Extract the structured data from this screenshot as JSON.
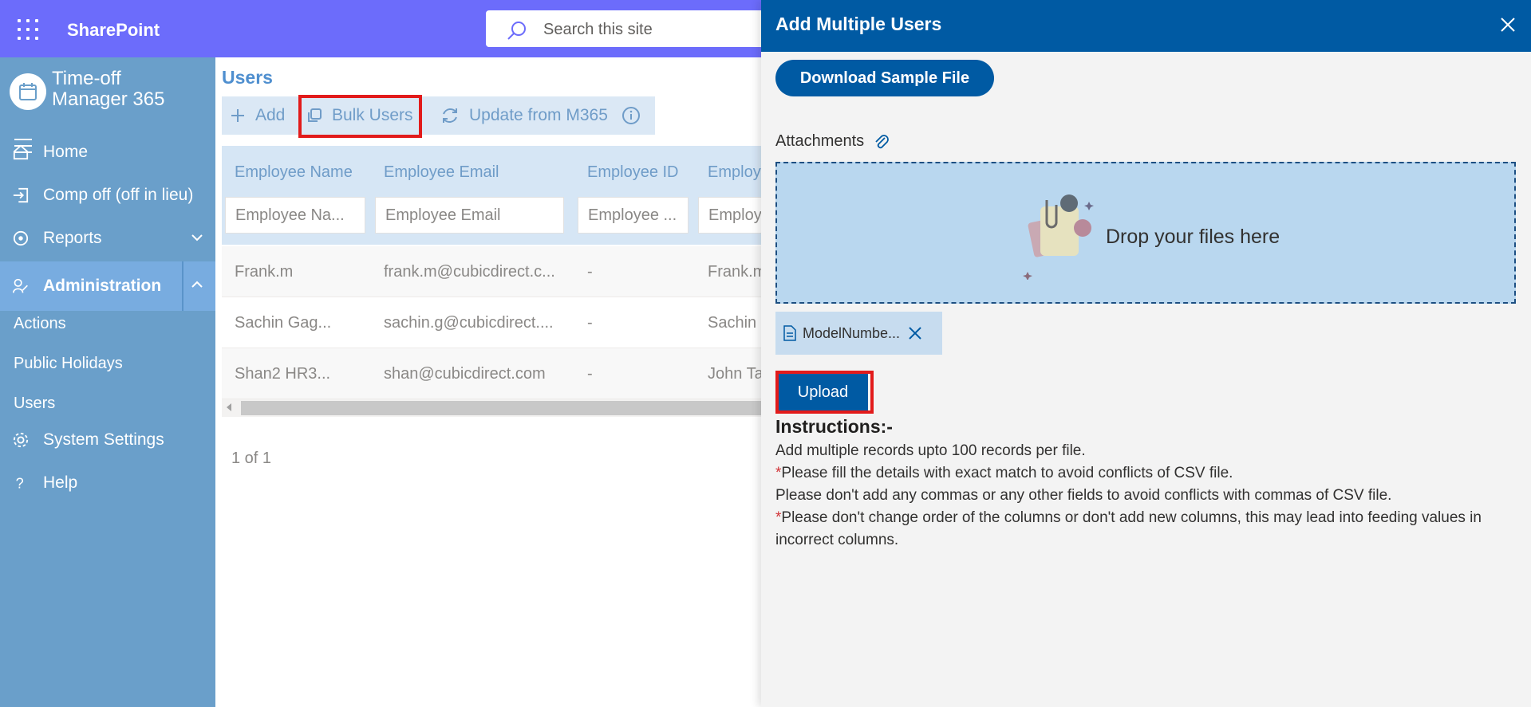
{
  "suite": {
    "app_name": "SharePoint",
    "search_placeholder": "Search this site",
    "bar_color": "#6c6cfb"
  },
  "nav": {
    "app_title_line1": "Time-off",
    "app_title_line2": "Manager 365",
    "items": [
      {
        "label": "Home",
        "icon": "home-icon"
      },
      {
        "label": "Comp off (off in lieu)",
        "icon": "sign-in-icon"
      },
      {
        "label": "Reports",
        "icon": "reports-icon"
      },
      {
        "label": "Administration",
        "icon": "admin-user-icon",
        "active": true
      }
    ],
    "admin_sub_items": [
      "Actions",
      "Public Holidays",
      "Users"
    ],
    "system_settings": "System Settings",
    "help": "Help"
  },
  "main": {
    "title": "Users",
    "toolbar": {
      "add": "Add",
      "bulk_users": "Bulk Users",
      "update": "Update from M365"
    },
    "table": {
      "headers": [
        "Employee Name",
        "Employee Email",
        "Employee ID",
        "Employ"
      ],
      "filters": [
        "Employee Na...",
        "Employee Email",
        "Employee ...",
        "Employ"
      ],
      "rows": [
        [
          "Frank.m",
          "frank.m@cubicdirect.c...",
          "-",
          "Frank.m"
        ],
        [
          "Sachin Gag...",
          "sachin.g@cubicdirect....",
          "-",
          "Sachin"
        ],
        [
          "Shan2 HR3...",
          "shan@cubicdirect.com",
          "-",
          "John Ta"
        ]
      ]
    },
    "pager": "1 of 1"
  },
  "panel": {
    "title": "Add Multiple Users",
    "download_button": "Download Sample File",
    "attachments_label": "Attachments",
    "drop_text": "Drop your files here",
    "file_name": "ModelNumbe...",
    "upload_button": "Upload",
    "instructions_title": "Instructions:-",
    "instructions": [
      {
        "star": "",
        "text": "Add multiple records upto 100 records per file."
      },
      {
        "star": "*",
        "text": "Please fill the details with exact match to avoid conflicts of CSV file."
      },
      {
        "star": "",
        "text": "Please don't add any commas or any other fields to avoid conflicts with commas of CSV file."
      },
      {
        "star": "*",
        "text": "Please don't change order of the columns or don't add new columns, this may lead into feeding values in incorrect columns."
      }
    ],
    "header_color": "#005aa3",
    "highlight_color": "#e21b1b"
  }
}
